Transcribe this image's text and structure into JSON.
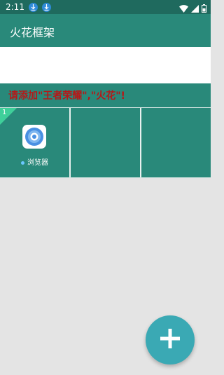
{
  "status_bar": {
    "time": "2:11",
    "icons": [
      "download-icon",
      "download-icon",
      "wifi-icon",
      "signal-icon",
      "battery-icon"
    ]
  },
  "app_bar": {
    "title": "火花框架"
  },
  "notice": {
    "text": "请添加\"王者荣耀\",\"火花\"!"
  },
  "grid": {
    "slots": [
      {
        "badge": "1",
        "app_label": "浏览器",
        "icon": "browser-icon"
      },
      {
        "badge": "",
        "app_label": ""
      },
      {
        "badge": "",
        "app_label": ""
      }
    ]
  },
  "fab": {
    "icon": "plus-icon"
  },
  "colors": {
    "primary": "#29897a",
    "status_bar": "#1f6a5e",
    "notice_text": "#b51818",
    "fab": "#3aa9b4",
    "background": "#e4e4e4"
  }
}
